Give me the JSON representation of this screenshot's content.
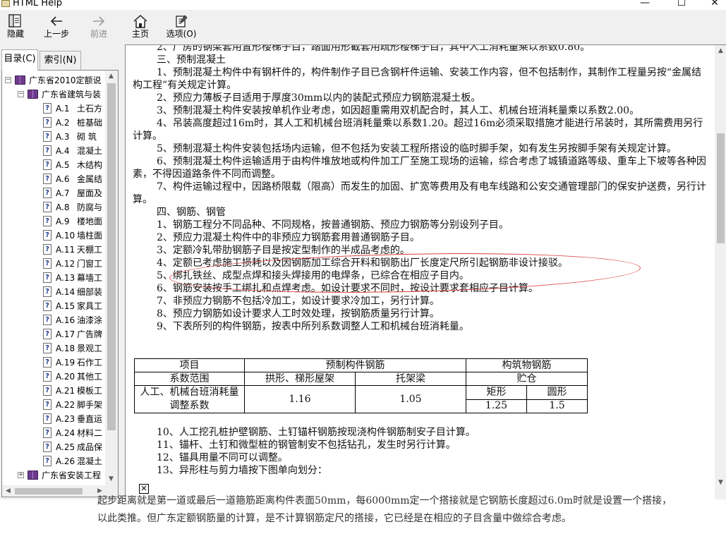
{
  "window": {
    "title": "HTML Help"
  },
  "toolbar": {
    "hide": "隐藏",
    "back": "上一步",
    "forward": "前进",
    "home": "主页",
    "options": "选项(O)"
  },
  "nav_tabs": {
    "contents": "目录(C)",
    "index": "索引(N)"
  },
  "tree": {
    "root": "广东省2010定额说",
    "book": "广东省建筑与装",
    "items": [
      {
        "code": "A.1",
        "name": "土石方"
      },
      {
        "code": "A.2",
        "name": "桩基础"
      },
      {
        "code": "A.3",
        "name": "砌  筑"
      },
      {
        "code": "A.4",
        "name": "混凝土"
      },
      {
        "code": "A.5",
        "name": "木结构"
      },
      {
        "code": "A.6",
        "name": "金属结"
      },
      {
        "code": "A.7",
        "name": "屋面及"
      },
      {
        "code": "A.8",
        "name": "防腐与"
      },
      {
        "code": "A.9",
        "name": "楼地面"
      },
      {
        "code": "A.10",
        "name": "墙柱面"
      },
      {
        "code": "A.11",
        "name": "天棚工"
      },
      {
        "code": "A.12",
        "name": "门窗工"
      },
      {
        "code": "A.13",
        "name": "幕墙工"
      },
      {
        "code": "A.14",
        "name": "细部装"
      },
      {
        "code": "A.15",
        "name": "家具工"
      },
      {
        "code": "A.16",
        "name": "油漆涂"
      },
      {
        "code": "A.17",
        "name": "广告牌"
      },
      {
        "code": "A.18",
        "name": "景观工"
      },
      {
        "code": "A.19",
        "name": "石作工"
      },
      {
        "code": "A.20",
        "name": "其他工"
      },
      {
        "code": "A.21",
        "name": "模板工"
      },
      {
        "code": "A.22",
        "name": "脚手架"
      },
      {
        "code": "A.23",
        "name": "垂直运"
      },
      {
        "code": "A.24",
        "name": "材料二"
      },
      {
        "code": "A.25",
        "name": "成品保"
      },
      {
        "code": "A.26",
        "name": "混凝土"
      }
    ],
    "last_book": "广东省安装工程"
  },
  "doc": {
    "paragraphs": [
      {
        "style": "ind",
        "text": "2、厂房的钢梁套用置形楼梯子目，踏面用形截套用疏形楼梯子目，其中人工消耗量乘以系数0.80。"
      },
      {
        "style": "head",
        "text": "三、预制混凝土"
      },
      {
        "style": "ind",
        "text": "1、预制混凝土构件中有钢杆件的，构件制作子目已含钢杆件运输、安装工作内容，但不包括制作，其制作工程量另按“金属结构工程”有关规定计算。"
      },
      {
        "style": "ind",
        "text": "2、预应力薄板子目适用于厚度30mm以内的装配式预应力钢筋混凝土板。"
      },
      {
        "style": "ind",
        "text": "3、预制混凝土构件安装按单机作业考虑，如因超重需用双机配合时，其人工、机械台班消耗量乘以系数2.00。"
      },
      {
        "style": "ind",
        "text": "4、吊装高度超过16m时，其人工和机械台班消耗量乘以系数1.20。超过16m必须采取措施才能进行吊装时，其所需费用另行计算。"
      },
      {
        "style": "ind",
        "text": "5、预制混凝土构件安装包括场内运输，但不包括为安装工程所搭设的临时脚手架，如有发生另按脚手架有关规定计算。"
      },
      {
        "style": "ind",
        "text": "6、预制混凝土构件运输适用于由构件堆放地或构件加工厂至施工现场的运输，综合考虑了城镇道路等级、重车上下坡等各种因素，不得因道路条件不同而调整。"
      },
      {
        "style": "ind",
        "text": "7、构件运输过程中，因路桥限载（限高）而发生的加固、扩宽等费用及有电车线路和公安交通管理部门的保安护送费，另行计算。"
      },
      {
        "style": "head",
        "text": "四、钢筋、钢管"
      },
      {
        "style": "ind",
        "text": "1、钢筋工程分不同品种、不同规格，按普通钢筋、预应力钢筋等分别设列子目。"
      },
      {
        "style": "ind",
        "text": "2、预应力混凝土构件中的非预应力钢筋套用普通钢筋子目。"
      },
      {
        "style": "ind",
        "text": "3、定额冷轧带肋钢筋子目是按定型制作的半成品考虑的。"
      },
      {
        "style": "ind",
        "text": "4、定额已考虑施工损耗以及因钢筋加工综合开料和钢筋出厂长度定尺所引起钢筋非设计接驳。"
      },
      {
        "style": "ind",
        "text": "5、绑扎铁丝、成型点焊和接头焊接用的电焊条，已综合在相应子目内。"
      },
      {
        "style": "ind",
        "text": "6、钢筋安装按手工绑扎和点焊考虑。如设计要求不同时，按设计要求套相应子目计算。"
      },
      {
        "style": "ind",
        "text": "7、非预应力钢筋不包括冷加工，如设计要求冷加工，另行计算。"
      },
      {
        "style": "ind",
        "text": "8、预应力钢筋如设计要求人工时效处理，按钢筋质量另行计算。"
      },
      {
        "style": "ind",
        "text": "9、下表所列的构件钢筋，按表中所列系数调整人工和机械台班消耗量。"
      }
    ],
    "table": {
      "h_item": "项目",
      "h_precast": "预制构件钢筋",
      "h_structure": "构筑物钢筋",
      "h_range": "系数范围",
      "h_arch": "拱形、梯形屋架",
      "h_bracket": "托架梁",
      "h_silo": "贮仓",
      "h_rect": "矩形",
      "h_round": "圆形",
      "row_label": "人工、机械台班消耗量调整系数",
      "v_arch": "1.16",
      "v_bracket": "1.05",
      "v_rect": "1.25",
      "v_round": "1.5"
    },
    "after": [
      {
        "style": "ind",
        "text": "10、人工挖孔桩护壁钢筋、土钉锚杆钢筋按现浇构件钢筋制安子目计算。"
      },
      {
        "style": "ind",
        "text": "11、锚杆、土钉和微型桩的钢管制安不包括钻孔，发生时另行计算。"
      },
      {
        "style": "ind",
        "text": "12、锚具用量不同可以调整。"
      },
      {
        "style": "ind",
        "text": "13、异形柱与剪力墙按下图单向划分："
      }
    ]
  },
  "behind": {
    "line1": "起步距离就是第一道或最后一道箍筋距离构件表面50mm，每6000mm定一个搭接就是它钢筋长度超过6.0m时就是设置一个搭接，",
    "line2": "以此类推。但广东定额钢筋量的计算，是不计算钢筋定尺的搭接，它已经是在相应的子目含量中做综合考虑。"
  }
}
